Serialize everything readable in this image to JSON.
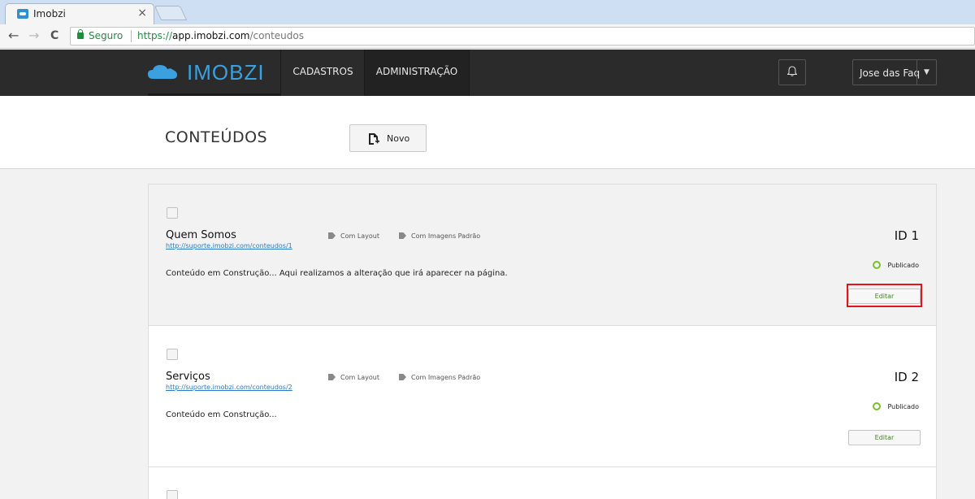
{
  "browser": {
    "tab_title": "Imobzi",
    "tab_close": "×",
    "back": "←",
    "forward": "→",
    "reload": "C",
    "secure_label": "Seguro",
    "url_scheme": "https://",
    "url_host": "app.imobzi.com",
    "url_path": "/conteudos"
  },
  "navbar": {
    "logo_text": "IMOBZI",
    "items": [
      {
        "label": "CADASTROS"
      },
      {
        "label": "ADMINISTRAÇÃO"
      }
    ],
    "user_name": "Jose das Faq",
    "user_caret": "▼"
  },
  "page": {
    "title": "CONTEÚDOS",
    "new_button_label": "Novo"
  },
  "items": [
    {
      "title": "Quem Somos",
      "link": "http://suporte.imobzi.com/conteudos/1",
      "tags": [
        "Com Layout",
        "Com Imagens Padrão"
      ],
      "description": "Conteúdo em Construção...  Aqui realizamos a alteração que irá aparecer na página.",
      "id_label": "ID 1",
      "status": "Publicado",
      "edit_label": "Editar"
    },
    {
      "title": "Serviços",
      "link": "http://suporte.imobzi.com/conteudos/2",
      "tags": [
        "Com Layout",
        "Com Imagens Padrão"
      ],
      "description": "Conteúdo em Construção...",
      "id_label": "ID 2",
      "status": "Publicado",
      "edit_label": "Editar"
    }
  ],
  "colors": {
    "brand": "#3aa0de",
    "navbar": "#2b2b2b",
    "status_published": "#7bbf2a",
    "highlight": "#e3141b"
  }
}
